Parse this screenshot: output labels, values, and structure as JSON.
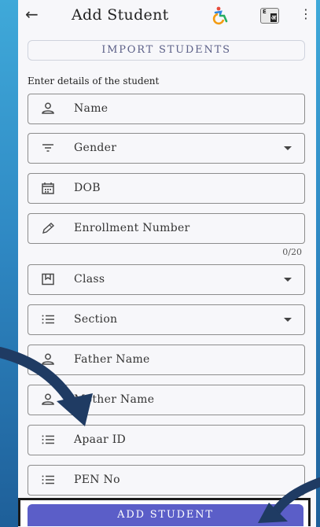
{
  "header": {
    "title": "Add Student",
    "back_icon": "arrow-left-icon",
    "accessibility_icon": "wheelchair-accessibility-icon",
    "language_icon": "translate-icon",
    "language_label_left": "E",
    "language_label_right": "अ",
    "more_icon": "more-vert-icon"
  },
  "import_button": "IMPORT STUDENTS",
  "form": {
    "section_label": "Enter details of the student",
    "fields": [
      {
        "label": "Name",
        "icon": "person-icon"
      },
      {
        "label": "Gender",
        "icon": "filter-icon",
        "dropdown": true
      },
      {
        "label": "DOB",
        "icon": "calendar-icon"
      },
      {
        "label": "Enrollment Number",
        "icon": "pencil-icon",
        "counter": "0/20"
      },
      {
        "label": "Class",
        "icon": "bookmark-icon",
        "dropdown": true
      },
      {
        "label": "Section",
        "icon": "list-icon",
        "dropdown": true
      },
      {
        "label": "Father Name",
        "icon": "person-icon"
      },
      {
        "label": "Mother Name",
        "icon": "person-icon"
      },
      {
        "label": "Apaar ID",
        "icon": "list-icon"
      },
      {
        "label": "PEN No",
        "icon": "list-icon"
      }
    ]
  },
  "submit_button": "ADD STUDENT",
  "colors": {
    "accent": "#5b5ec8",
    "outer_background": "#2f89c4",
    "arrow": "#1f3b63"
  }
}
